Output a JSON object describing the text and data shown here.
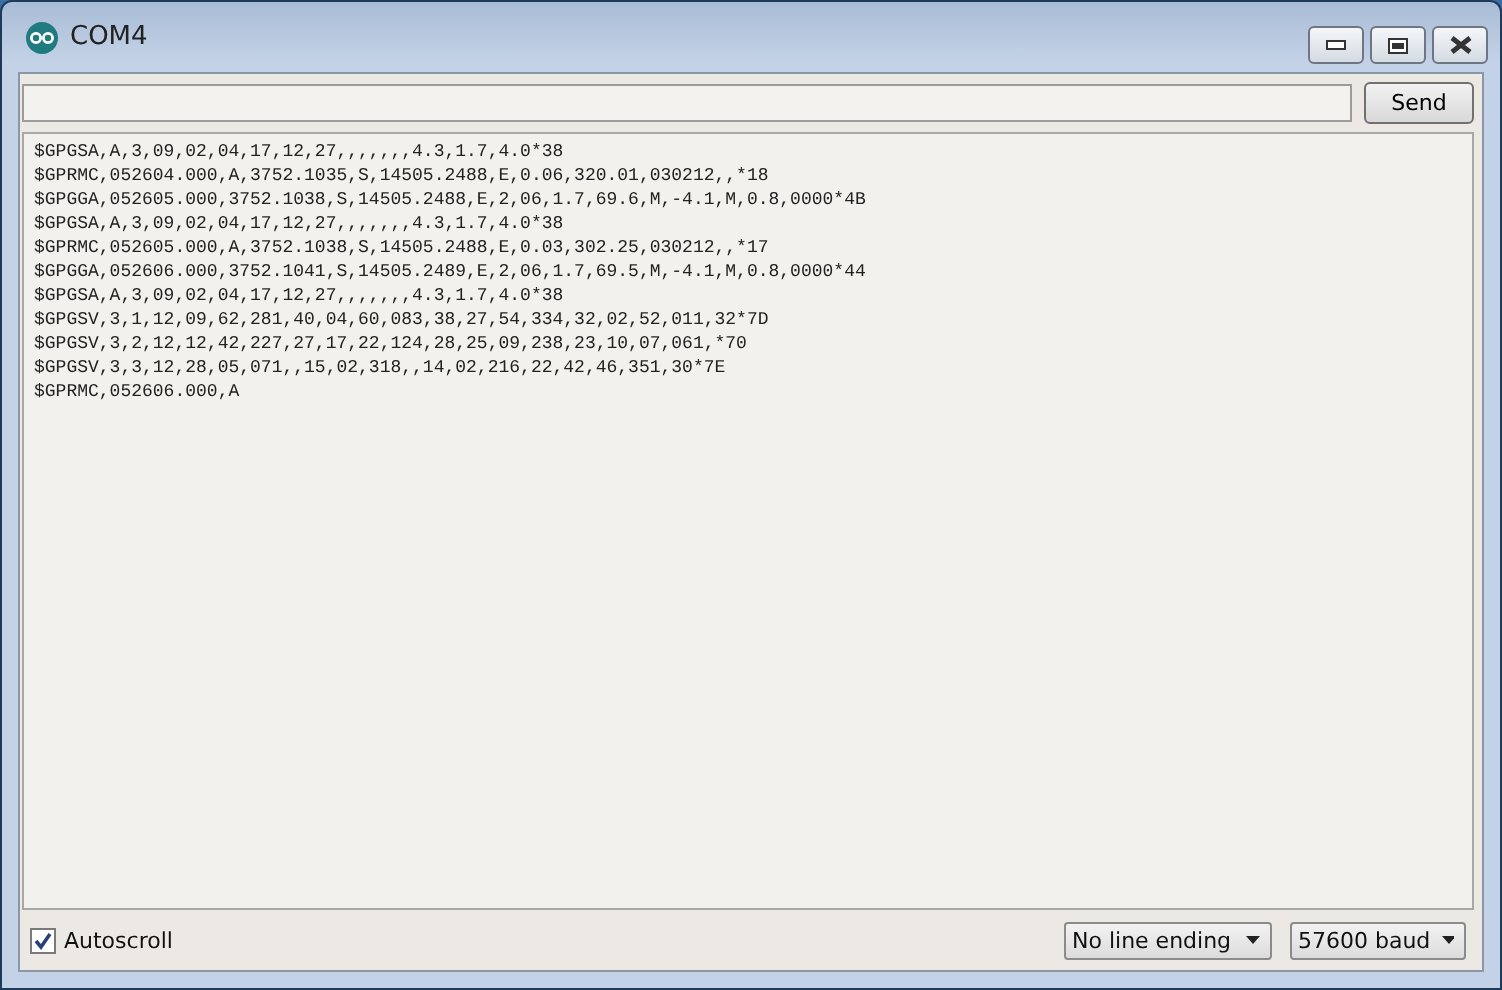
{
  "window": {
    "title": "COM4"
  },
  "send_button": {
    "label": "Send"
  },
  "output_lines": [
    "$GPGSA,A,3,09,02,04,17,12,27,,,,,,,4.3,1.7,4.0*38",
    "$GPRMC,052604.000,A,3752.1035,S,14505.2488,E,0.06,320.01,030212,,*18",
    "$GPGGA,052605.000,3752.1038,S,14505.2488,E,2,06,1.7,69.6,M,-4.1,M,0.8,0000*4B",
    "$GPGSA,A,3,09,02,04,17,12,27,,,,,,,4.3,1.7,4.0*38",
    "$GPRMC,052605.000,A,3752.1038,S,14505.2488,E,0.03,302.25,030212,,*17",
    "$GPGGA,052606.000,3752.1041,S,14505.2489,E,2,06,1.7,69.5,M,-4.1,M,0.8,0000*44",
    "$GPGSA,A,3,09,02,04,17,12,27,,,,,,,4.3,1.7,4.0*38",
    "$GPGSV,3,1,12,09,62,281,40,04,60,083,38,27,54,334,32,02,52,011,32*7D",
    "$GPGSV,3,2,12,12,42,227,27,17,22,124,28,25,09,238,23,10,07,061,*70",
    "$GPGSV,3,3,12,28,05,071,,15,02,318,,14,02,216,22,42,46,351,30*7E",
    "$GPRMC,052606.000,A"
  ],
  "autoscroll": {
    "label": "Autoscroll",
    "checked": true
  },
  "line_ending": {
    "value": "No line ending"
  },
  "baud": {
    "value": "57600 baud"
  }
}
